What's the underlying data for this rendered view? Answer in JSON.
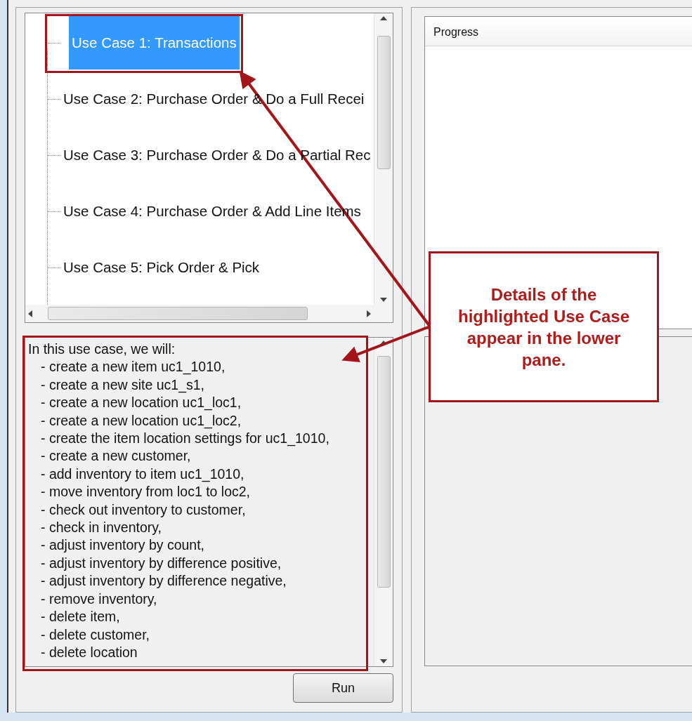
{
  "tree": {
    "items": [
      {
        "label": "Use Case 1: Transactions",
        "selected": true
      },
      {
        "label": "Use Case 2: Purchase Order & Do a Full Recei",
        "selected": false
      },
      {
        "label": "Use Case 3: Purchase Order & Do a Partial Rec",
        "selected": false
      },
      {
        "label": "Use Case 4: Purchase Order & Add Line Items",
        "selected": false
      },
      {
        "label": "Use Case 5: Pick Order & Pick",
        "selected": false
      }
    ]
  },
  "details": {
    "intro": "In this use case, we will:",
    "steps": [
      "- create a new item uc1_1010,",
      "- create a new site uc1_s1,",
      "- create a new location uc1_loc1,",
      "- create a new location uc1_loc2,",
      "- create the item location settings for uc1_1010,",
      "- create a new customer,",
      "- add inventory to item uc1_1010,",
      "- move inventory from loc1 to loc2,",
      "- check out inventory to customer,",
      "- check in inventory,",
      "- adjust inventory by count,",
      "- adjust inventory by difference positive,",
      "- adjust inventory by difference negative,",
      "- remove inventory,",
      "- delete item,",
      "- delete customer,",
      "- delete location"
    ]
  },
  "run_button": "Run",
  "progress": {
    "header": "Progress"
  },
  "annotation": {
    "callout": "Details of the highlighted Use Case appear in the lower pane."
  }
}
